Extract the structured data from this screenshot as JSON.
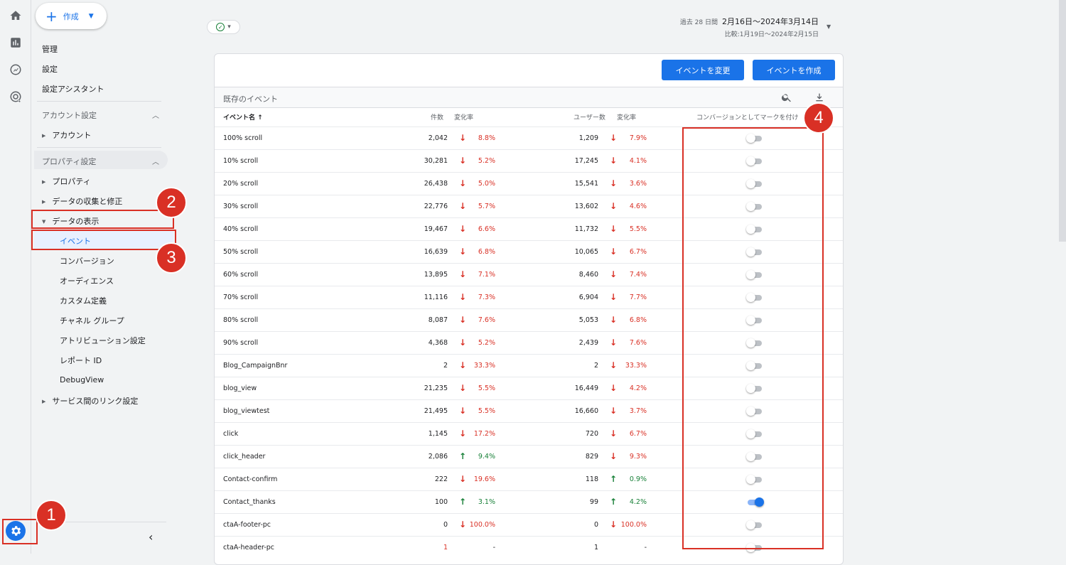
{
  "rail": {
    "icons": [
      "home-icon",
      "reports-icon",
      "explore-icon",
      "advertising-icon"
    ],
    "settings_icon": "gear-icon"
  },
  "nav": {
    "create_label": "作成",
    "top_items": [
      "管理",
      "設定",
      "設定アシスタント"
    ],
    "account_section": "アカウント設定",
    "account_item": "アカウント",
    "property_section": "プロパティ設定",
    "property_items": [
      "プロパティ",
      "データの収集と修正",
      "データの表示"
    ],
    "display_subitems": [
      "イベント",
      "コンバージョン",
      "オーディエンス",
      "カスタム定義",
      "チャネル グループ",
      "アトリビューション設定",
      "レポート ID",
      "DebugView"
    ],
    "service_links": "サービス間のリンク設定",
    "collapse_icon": "‹"
  },
  "annotations": {
    "b1": "1",
    "b2": "2",
    "b3": "3",
    "b4": "4"
  },
  "date": {
    "prefix": "過去 28 日間",
    "range": "2月16日～2024年3月14日",
    "compare": "比較:1月19日～2024年2月15日"
  },
  "actions": {
    "modify": "イベントを変更",
    "create": "イベントを作成"
  },
  "table": {
    "title": "既存のイベント",
    "headers": {
      "name": "イベント名 ↑",
      "count": "件数",
      "count_change": "変化率",
      "users": "ユーザー数",
      "users_change": "変化率",
      "conversion": "コンバージョンとしてマークを付け"
    },
    "rows": [
      {
        "name": "100% scroll",
        "count": "2,042",
        "cdir": "down",
        "cpct": "8.8%",
        "users": "1,209",
        "udir": "down",
        "upct": "7.9%",
        "conv": false
      },
      {
        "name": "10% scroll",
        "count": "30,281",
        "cdir": "down",
        "cpct": "5.2%",
        "users": "17,245",
        "udir": "down",
        "upct": "4.1%",
        "conv": false
      },
      {
        "name": "20% scroll",
        "count": "26,438",
        "cdir": "down",
        "cpct": "5.0%",
        "users": "15,541",
        "udir": "down",
        "upct": "3.6%",
        "conv": false
      },
      {
        "name": "30% scroll",
        "count": "22,776",
        "cdir": "down",
        "cpct": "5.7%",
        "users": "13,602",
        "udir": "down",
        "upct": "4.6%",
        "conv": false
      },
      {
        "name": "40% scroll",
        "count": "19,467",
        "cdir": "down",
        "cpct": "6.6%",
        "users": "11,732",
        "udir": "down",
        "upct": "5.5%",
        "conv": false
      },
      {
        "name": "50% scroll",
        "count": "16,639",
        "cdir": "down",
        "cpct": "6.8%",
        "users": "10,065",
        "udir": "down",
        "upct": "6.7%",
        "conv": false
      },
      {
        "name": "60% scroll",
        "count": "13,895",
        "cdir": "down",
        "cpct": "7.1%",
        "users": "8,460",
        "udir": "down",
        "upct": "7.4%",
        "conv": false
      },
      {
        "name": "70% scroll",
        "count": "11,116",
        "cdir": "down",
        "cpct": "7.3%",
        "users": "6,904",
        "udir": "down",
        "upct": "7.7%",
        "conv": false
      },
      {
        "name": "80% scroll",
        "count": "8,087",
        "cdir": "down",
        "cpct": "7.6%",
        "users": "5,053",
        "udir": "down",
        "upct": "6.8%",
        "conv": false
      },
      {
        "name": "90% scroll",
        "count": "4,368",
        "cdir": "down",
        "cpct": "5.2%",
        "users": "2,439",
        "udir": "down",
        "upct": "7.6%",
        "conv": false
      },
      {
        "name": "Blog_CampaignBnr",
        "count": "2",
        "cdir": "down",
        "cpct": "33.3%",
        "users": "2",
        "udir": "down",
        "upct": "33.3%",
        "conv": false
      },
      {
        "name": "blog_view",
        "count": "21,235",
        "cdir": "down",
        "cpct": "5.5%",
        "users": "16,449",
        "udir": "down",
        "upct": "4.2%",
        "conv": false
      },
      {
        "name": "blog_viewtest",
        "count": "21,495",
        "cdir": "down",
        "cpct": "5.5%",
        "users": "16,660",
        "udir": "down",
        "upct": "3.7%",
        "conv": false
      },
      {
        "name": "click",
        "count": "1,145",
        "cdir": "down",
        "cpct": "17.2%",
        "users": "720",
        "udir": "down",
        "upct": "6.7%",
        "conv": false
      },
      {
        "name": "click_header",
        "count": "2,086",
        "cdir": "up",
        "cpct": "9.4%",
        "users": "829",
        "udir": "down",
        "upct": "9.3%",
        "conv": false
      },
      {
        "name": "Contact-confirm",
        "count": "222",
        "cdir": "down",
        "cpct": "19.6%",
        "users": "118",
        "udir": "up",
        "upct": "0.9%",
        "conv": false
      },
      {
        "name": "Contact_thanks",
        "count": "100",
        "cdir": "up",
        "cpct": "3.1%",
        "users": "99",
        "udir": "up",
        "upct": "4.2%",
        "conv": true
      },
      {
        "name": "ctaA-footer-pc",
        "count": "0",
        "cdir": "down",
        "cpct": "100.0%",
        "users": "0",
        "udir": "down",
        "upct": "100.0%",
        "conv": false
      },
      {
        "name": "ctaA-header-pc",
        "count": "1",
        "cdir": "none",
        "cpct": "-",
        "users": "1",
        "udir": "none",
        "upct": "-",
        "conv": false
      }
    ]
  }
}
